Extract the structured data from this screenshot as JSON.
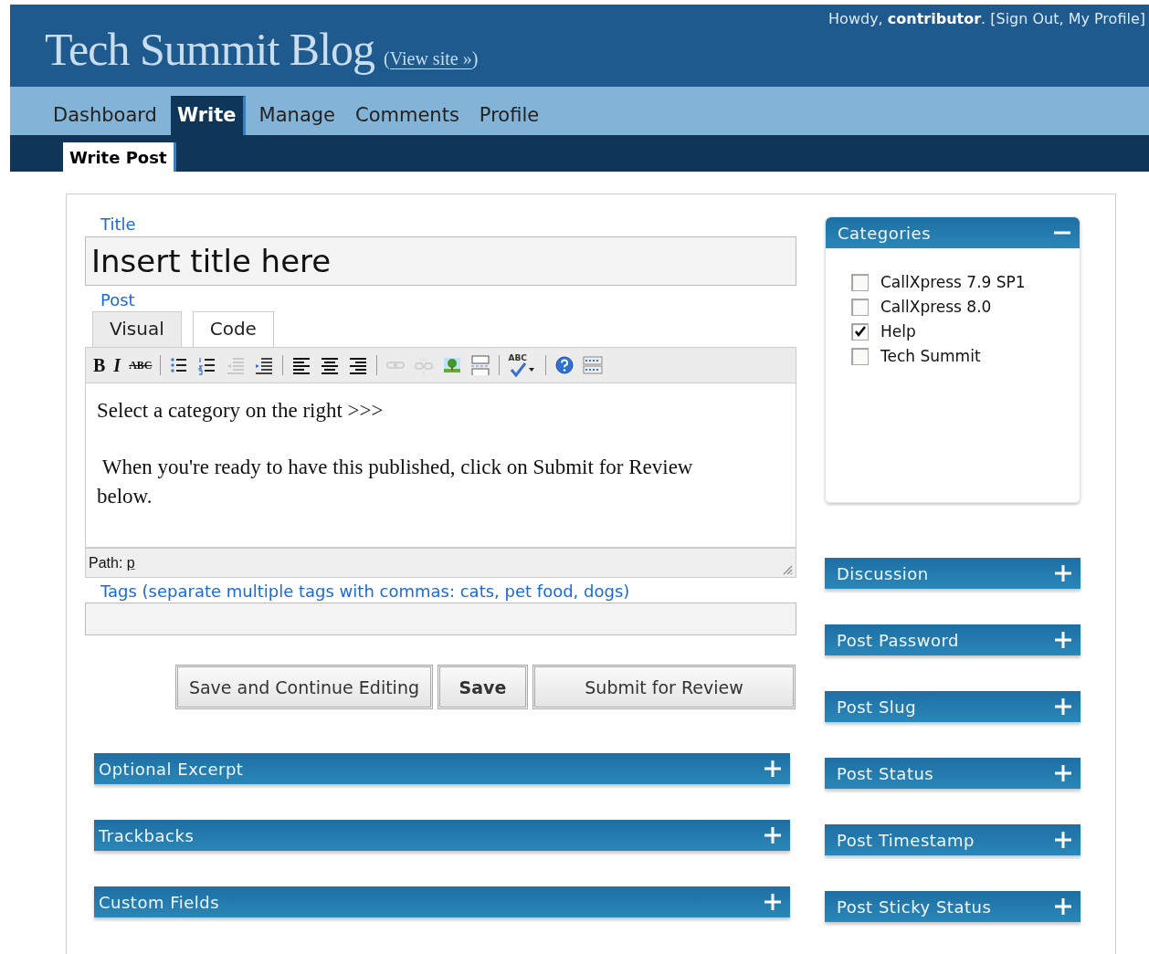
{
  "header": {
    "blog_title": "Tech Summit Blog",
    "view_site": [
      {
        "kind": "text",
        "text": "("
      },
      {
        "kind": "link",
        "text": "View site »"
      },
      {
        "kind": "text",
        "text": ")"
      }
    ],
    "greeting": [
      {
        "kind": "text",
        "text": "Howdy, **contributor**. ["
      },
      {
        "kind": "link",
        "text": "Sign Out"
      },
      {
        "kind": "text",
        "text": ", "
      },
      {
        "kind": "link",
        "text": "My Profile"
      },
      {
        "kind": "text",
        "text": "]"
      }
    ]
  },
  "tabs": [
    {
      "label": "Dashboard",
      "selected": false
    },
    {
      "label": "Write",
      "selected": true
    },
    {
      "label": "Manage",
      "selected": false
    },
    {
      "label": "Comments",
      "selected": false
    },
    {
      "label": "Profile",
      "selected": false
    }
  ],
  "subtabs": [
    {
      "label": "Write Post",
      "selected": true
    }
  ],
  "title_label": "Title",
  "title_value": "Insert title here",
  "post_label": "Post",
  "editor_tabs": [
    {
      "label": "Visual",
      "selected": true
    },
    {
      "label": "Code",
      "selected": false
    }
  ],
  "toolbar": [
    {
      "kind": "bold",
      "label": "B",
      "disabled": false
    },
    {
      "kind": "italic",
      "label": "I",
      "disabled": false
    },
    {
      "kind": "strike",
      "label": "ABC",
      "disabled": false
    },
    {
      "kind": "separator"
    },
    {
      "kind": "bullets",
      "disabled": false
    },
    {
      "kind": "numbers",
      "disabled": false
    },
    {
      "kind": "outdent",
      "disabled": true
    },
    {
      "kind": "indent",
      "disabled": false
    },
    {
      "kind": "separator"
    },
    {
      "kind": "align-left",
      "disabled": false
    },
    {
      "kind": "align-center",
      "disabled": false
    },
    {
      "kind": "align-right",
      "disabled": false
    },
    {
      "kind": "separator"
    },
    {
      "kind": "link",
      "disabled": true
    },
    {
      "kind": "unlink",
      "disabled": true
    },
    {
      "kind": "image",
      "disabled": false
    },
    {
      "kind": "more",
      "disabled": false
    },
    {
      "kind": "separator"
    },
    {
      "kind": "spellcheck",
      "label": "ABC",
      "disabled": false
    },
    {
      "kind": "separator"
    },
    {
      "kind": "help",
      "disabled": false
    },
    {
      "kind": "kitchen-sink",
      "disabled": false
    }
  ],
  "editor_paragraphs": [
    "Select a category on the right >>>",
    " When you're ready to have this published, click on Submit for Review below."
  ],
  "path_label": "Path:",
  "path_value": "p",
  "tags_label": "Tags (separate multiple tags with commas: cats, pet food, dogs)",
  "buttons": [
    {
      "label": "Save and Continue Editing",
      "kind": "normal"
    },
    {
      "label": "Save",
      "kind": "bold"
    },
    {
      "label": "Submit for Review",
      "kind": "wide"
    }
  ],
  "left_boxes": [
    {
      "title": "Optional Excerpt",
      "expanded": false
    },
    {
      "title": "Trackbacks",
      "expanded": false
    },
    {
      "title": "Custom Fields",
      "expanded": false
    }
  ],
  "categories": {
    "title": "Categories",
    "expanded": true,
    "items": [
      {
        "label": "CallXpress 7.9 SP1",
        "checked": false
      },
      {
        "label": "CallXpress 8.0",
        "checked": false
      },
      {
        "label": "Help",
        "checked": true
      },
      {
        "label": "Tech Summit",
        "checked": false
      }
    ]
  },
  "right_boxes": [
    {
      "title": "Discussion",
      "expanded": false
    },
    {
      "title": "Post Password",
      "expanded": false
    },
    {
      "title": "Post Slug",
      "expanded": false
    },
    {
      "title": "Post Status",
      "expanded": false
    },
    {
      "title": "Post Timestamp",
      "expanded": false
    },
    {
      "title": "Post Sticky Status",
      "expanded": false
    }
  ]
}
